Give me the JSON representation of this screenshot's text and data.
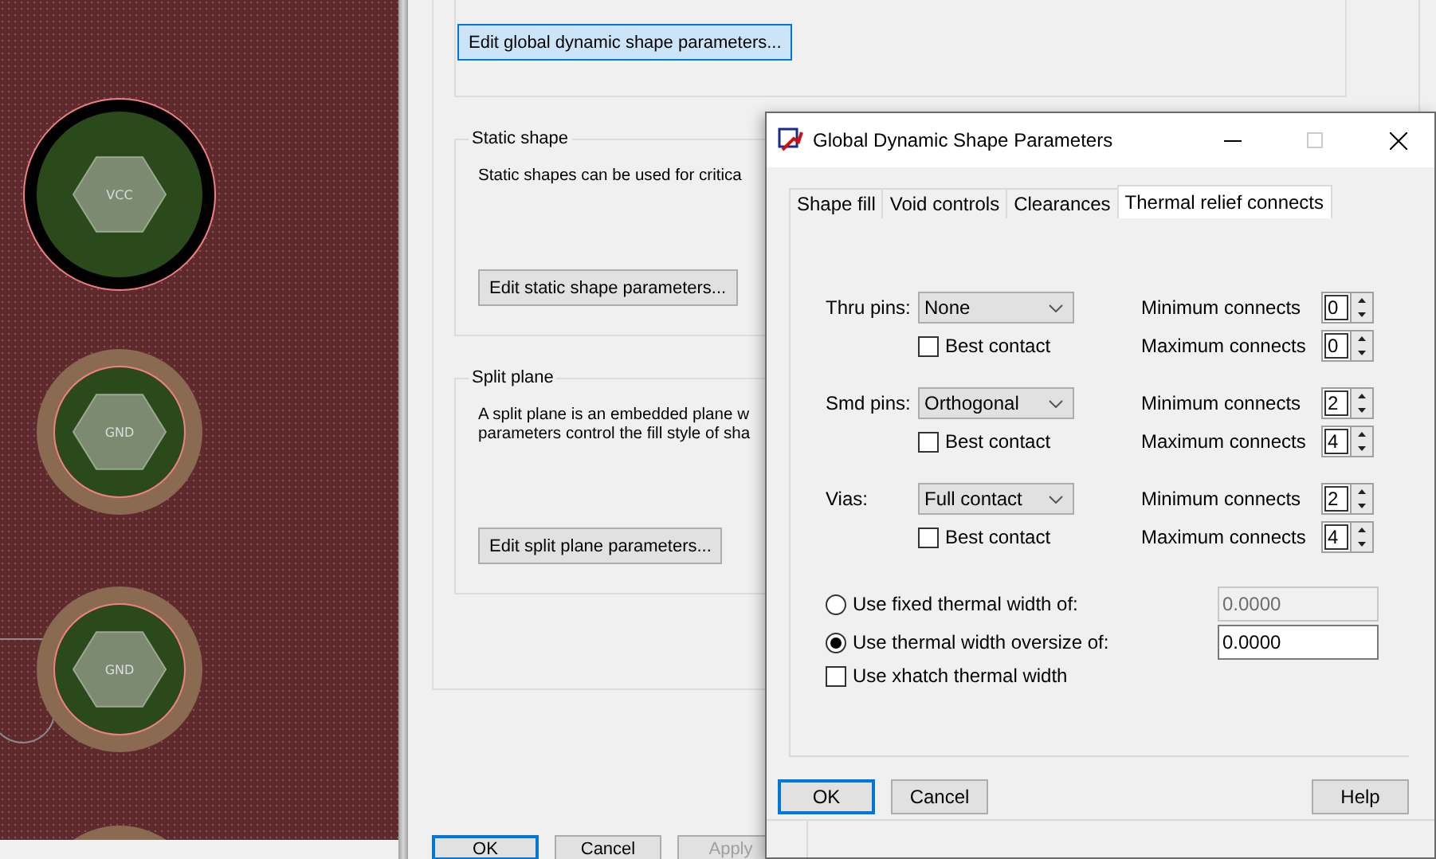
{
  "canvas": {
    "pads": [
      {
        "label": "VCC",
        "kind": "isolated"
      },
      {
        "label": "GND",
        "kind": "thermal"
      },
      {
        "label": "GND",
        "kind": "thermal"
      }
    ]
  },
  "main_dialog": {
    "top_button": {
      "label": "Edit global dynamic shape parameters...",
      "focused": true
    },
    "groups": [
      {
        "title": "Static shape",
        "description": [
          "Static shapes can be used for critica"
        ],
        "button": "Edit static shape parameters..."
      },
      {
        "title": "Split plane",
        "description": [
          "A split plane is an embedded plane w",
          "parameters control the fill style of sha"
        ],
        "button": "Edit split plane parameters..."
      }
    ],
    "buttons": [
      {
        "label": "OK",
        "default": true,
        "disabled": false
      },
      {
        "label": "Cancel",
        "default": false,
        "disabled": false
      },
      {
        "label": "Apply",
        "default": false,
        "disabled": true
      }
    ]
  },
  "dialog": {
    "title": "Global Dynamic Shape Parameters",
    "tabs": [
      {
        "label": "Shape fill",
        "selected": false
      },
      {
        "label": "Void controls",
        "selected": false
      },
      {
        "label": "Clearances",
        "selected": false
      },
      {
        "label": "Thermal relief connects",
        "selected": true
      }
    ],
    "connects": [
      {
        "label": "Thru pins:",
        "value": "None",
        "best_contact_label": "Best contact",
        "best_contact": false,
        "minimum_label": "Minimum connects",
        "minimum": "0",
        "maximum_label": "Maximum connects",
        "maximum": "0"
      },
      {
        "label": "Smd pins:",
        "value": "Orthogonal",
        "best_contact_label": "Best contact",
        "best_contact": false,
        "minimum_label": "Minimum connects",
        "minimum": "2",
        "maximum_label": "Maximum connects",
        "maximum": "4"
      },
      {
        "label": "Vias:",
        "value": "Full contact",
        "best_contact_label": "Best contact",
        "best_contact": false,
        "minimum_label": "Minimum connects",
        "minimum": "2",
        "maximum_label": "Maximum connects",
        "maximum": "4"
      }
    ],
    "width_options": [
      {
        "label": "Use fixed thermal width of:",
        "selected": false,
        "value": "0.0000"
      },
      {
        "label": "Use thermal width oversize of:",
        "selected": true,
        "value": "0.0000"
      }
    ],
    "xhatch": {
      "label": "Use xhatch thermal width",
      "checked": false
    },
    "buttons": [
      {
        "label": "OK",
        "default": true
      },
      {
        "label": "Cancel",
        "default": false
      },
      {
        "label": "Help",
        "default": false
      }
    ]
  }
}
